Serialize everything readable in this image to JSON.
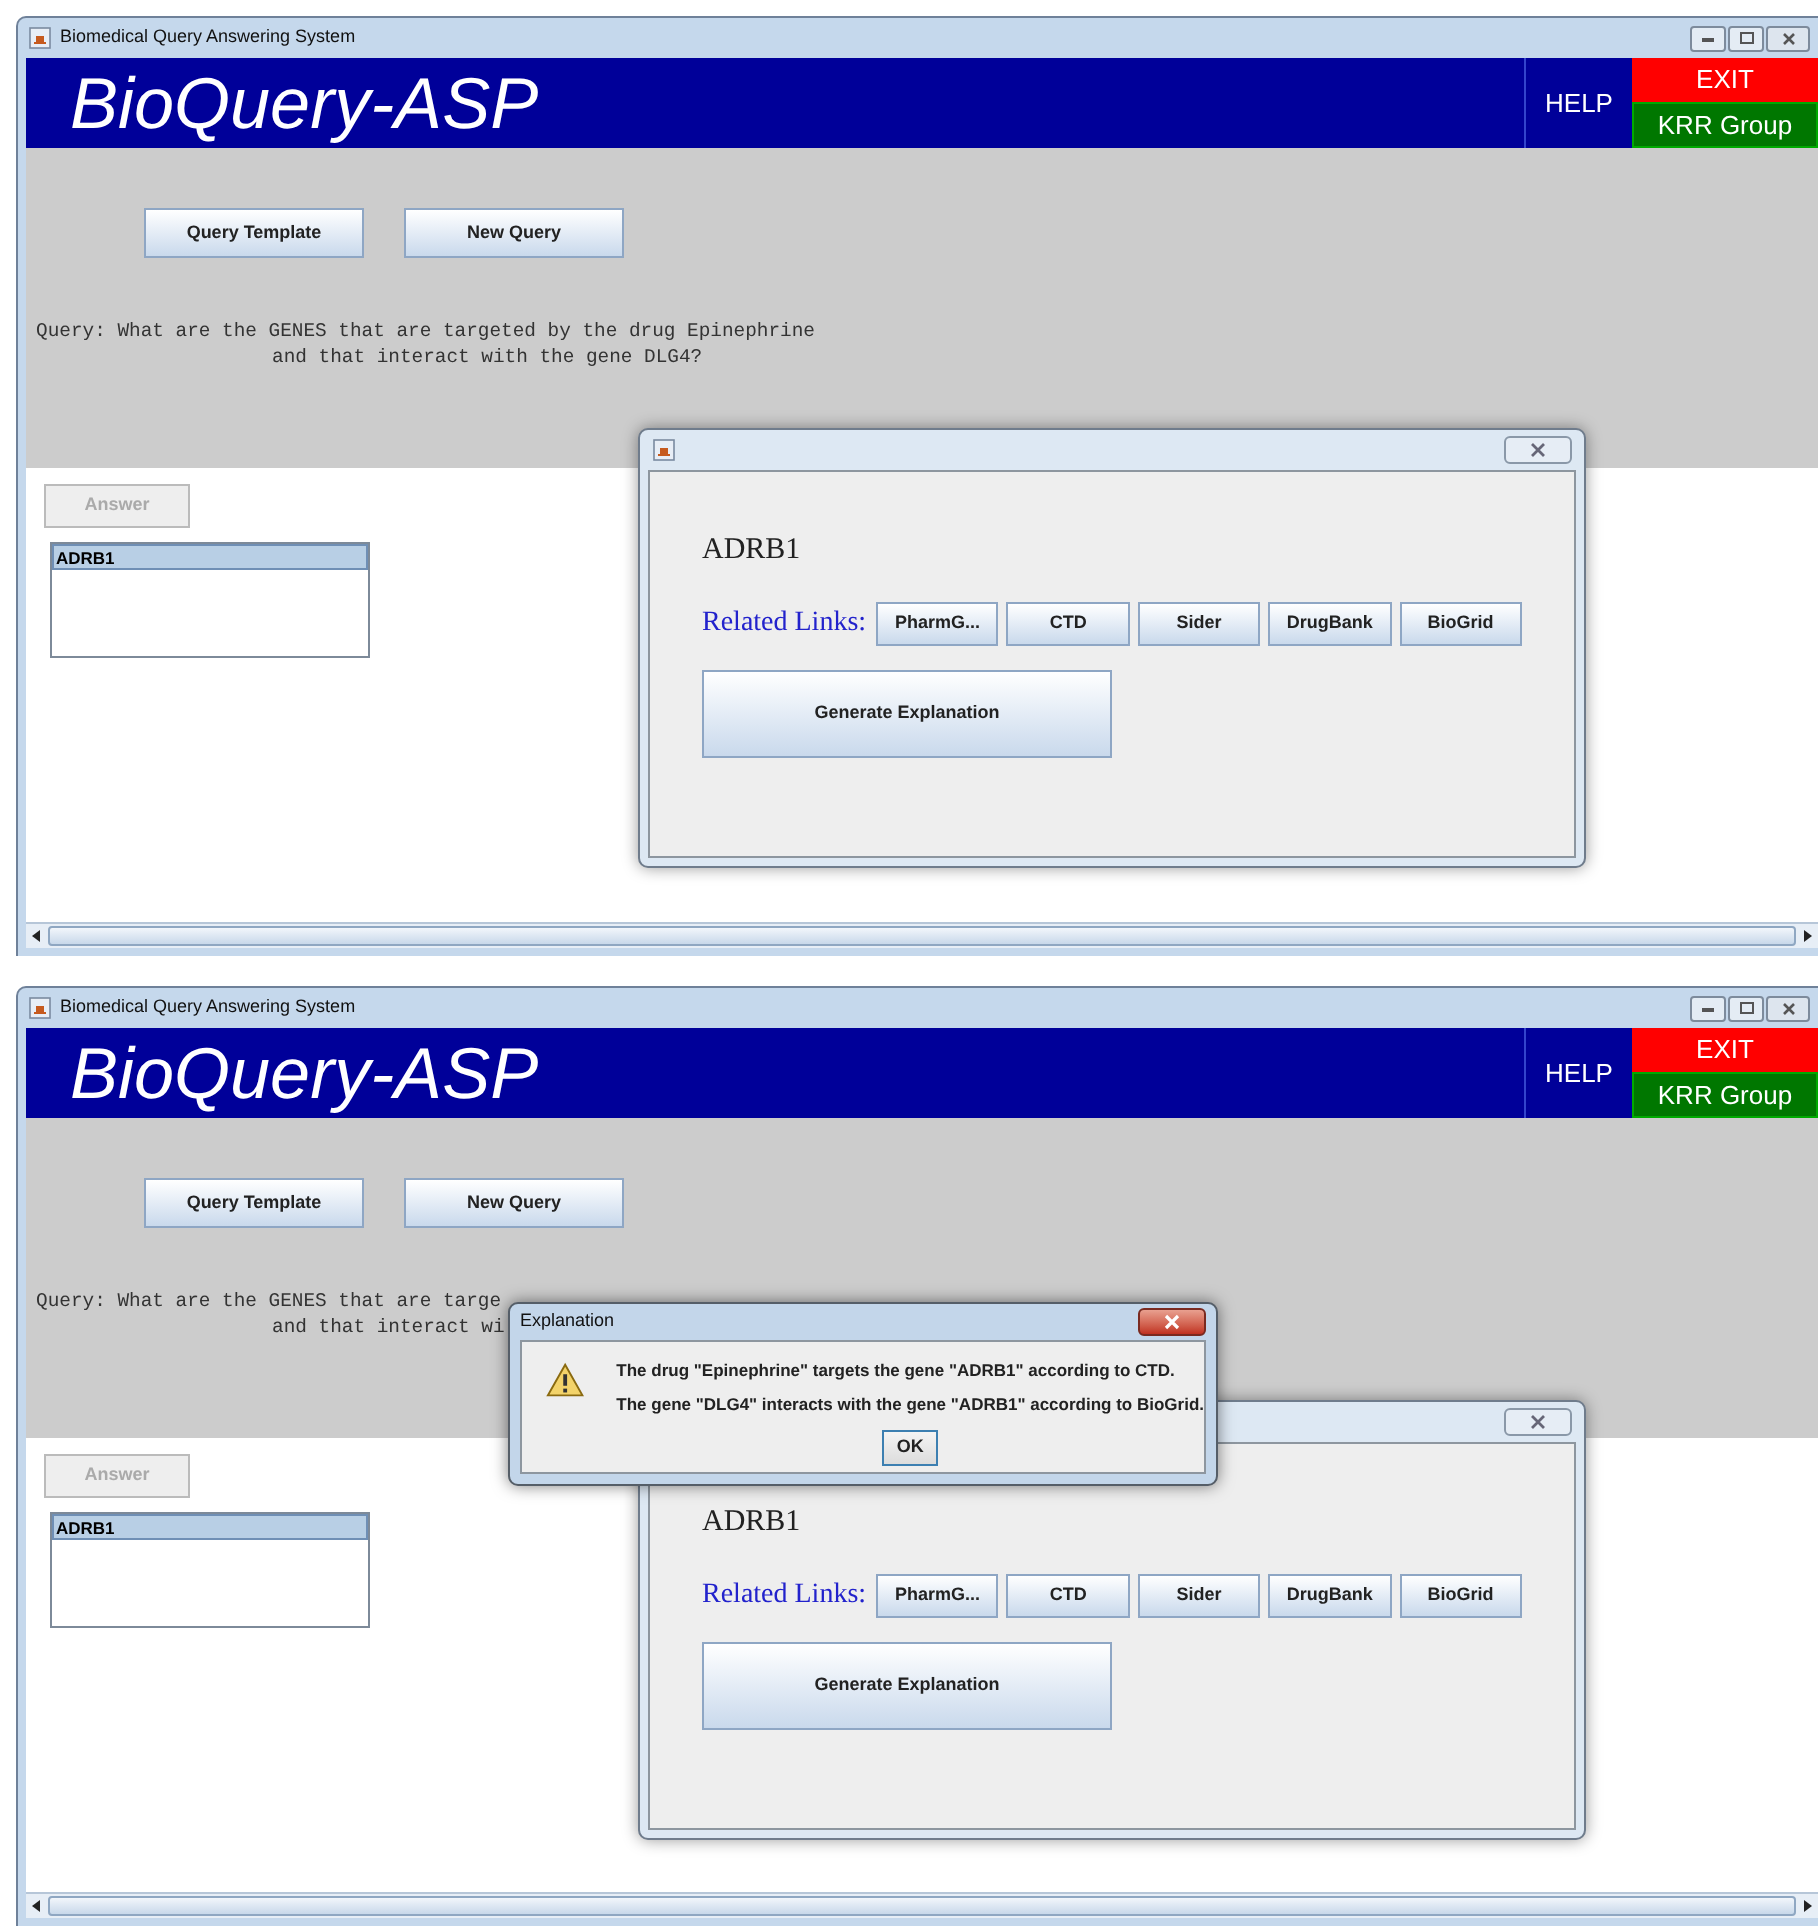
{
  "screens": [
    {
      "window": {
        "title": "Biomedical Query Answering System"
      },
      "header": {
        "title": "BioQuery-ASP",
        "help": "HELP",
        "exit": "EXIT",
        "group": "KRR Group"
      },
      "toolbar": [
        "Query Template",
        "New Query"
      ],
      "query": [
        "Query: What are the GENES that are targeted by the drug Epinephrine",
        "and that interact with the gene DLG4?"
      ],
      "answer_button": {
        "label": "Answer",
        "disabled": true
      },
      "answers": [
        {
          "label": "ADRB1",
          "selected": true
        }
      ],
      "result_dialog": {
        "gene": "ADRB1",
        "links_label": "Related Links:",
        "links": [
          "PharmG...",
          "CTD",
          "Sider",
          "DrugBank",
          "BioGrid"
        ],
        "generate_button": "Generate Explanation"
      }
    },
    {
      "window": {
        "title": "Biomedical Query Answering System"
      },
      "header": {
        "title": "BioQuery-ASP",
        "help": "HELP",
        "exit": "EXIT",
        "group": "KRR Group"
      },
      "toolbar": [
        "Query Template",
        "New Query"
      ],
      "query": [
        "Query: What are the GENES that are targe",
        "and that interact wi"
      ],
      "answer_button": {
        "label": "Answer",
        "disabled": true
      },
      "answers": [
        {
          "label": "ADRB1",
          "selected": true
        }
      ],
      "result_dialog": {
        "gene": "ADRB1",
        "links_label": "Related Links:",
        "links": [
          "PharmG...",
          "CTD",
          "Sider",
          "DrugBank",
          "BioGrid"
        ],
        "generate_button": "Generate Explanation"
      },
      "explanation_dialog": {
        "title": "Explanation",
        "lines": [
          "The drug \"Epinephrine\" targets the gene \"ADRB1\" according to CTD.",
          "The gene \"DLG4\" interacts with the gene \"ADRB1\" according to BioGrid."
        ],
        "ok": "OK"
      }
    }
  ]
}
